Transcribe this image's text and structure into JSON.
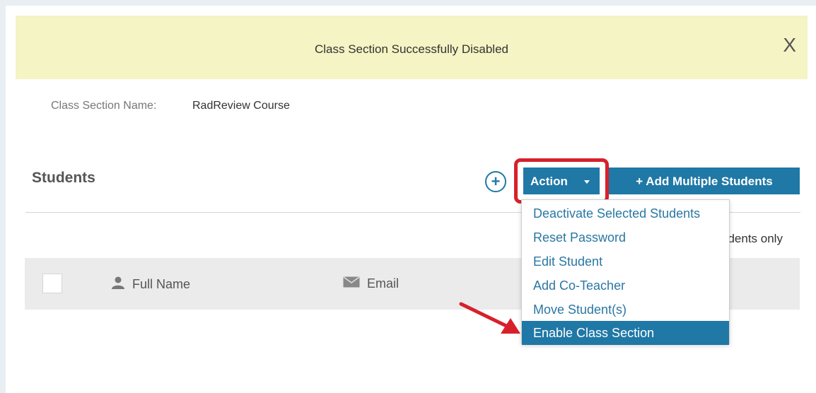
{
  "banner": {
    "message": "Class Section Successfully Disabled",
    "close_label": "X",
    "background": "#f4f4c4"
  },
  "class_section": {
    "label": "Class Section Name:",
    "value": "RadReview Course"
  },
  "students": {
    "title": "Students",
    "add_icon": "plus-circle-icon",
    "action_label": "Action",
    "add_multiple_label": "+ Add Multiple Students",
    "filter_text_partial": "udents only"
  },
  "table": {
    "columns": [
      {
        "label": "Full Name",
        "icon": "user-icon"
      },
      {
        "label": "Email",
        "icon": "envelope-icon"
      }
    ]
  },
  "action_menu": {
    "items": [
      {
        "label": "Deactivate Selected Students"
      },
      {
        "label": "Reset Password"
      },
      {
        "label": "Edit Student"
      },
      {
        "label": "Add Co-Teacher"
      },
      {
        "label": "Move Student(s)"
      },
      {
        "label": "Enable Class Section",
        "highlighted": true
      }
    ]
  },
  "colors": {
    "accent": "#1f78a6",
    "highlight_border": "#d8202a",
    "annotation_arrow": "#d8202a"
  }
}
